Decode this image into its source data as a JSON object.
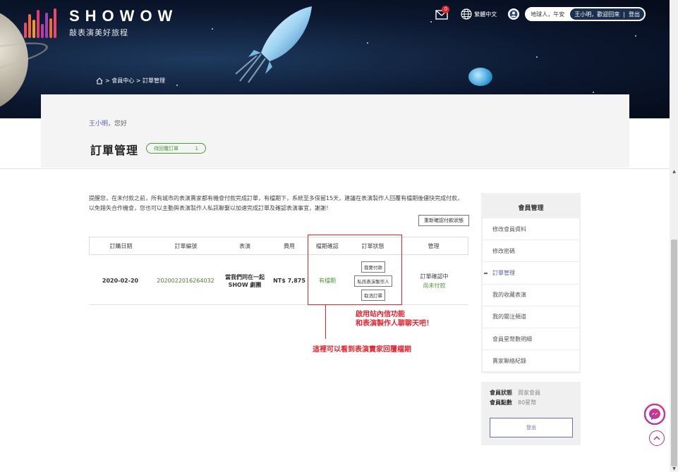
{
  "header": {
    "logo_name": "SHOWOW",
    "logo_tagline": "敲表演美好旅程",
    "mail_badge": "0",
    "language": "繁體中文",
    "user_greeting": "地球人，午安",
    "welcome_name": "王小明，歡迎回來",
    "logout_short": "登出",
    "breadcrumb": "> 會員中心 > 訂單管理"
  },
  "page": {
    "user_name": "王小明",
    "greeting_suffix": "，您好",
    "title": "訂單管理",
    "pending_label": "待回覆訂單",
    "pending_count": "1"
  },
  "notice": "提醒您，在未付款之前，所有城市的表演賣家都有機會付款完成訂單，有檔期下，系統至多保留15天，建議在表演製作人回覆有檔期後儘快完成付款，以免錯失合作機會，您也可以主動與表演製作人私訊聯繫以加速完成訂單及確認表演事宜，謝謝！",
  "reconfirm_button": "重新確認付款狀態",
  "table": {
    "headers": [
      "訂購日期",
      "訂單編號",
      "表演",
      "費用",
      "檔期確認",
      "訂單狀態",
      "管理"
    ],
    "rows": [
      {
        "date": "2020-02-20",
        "order_no": "2020022016264032",
        "show_line1": "當我們同在一起",
        "show_line2": "SHOW 劇團",
        "price": "NT$ 7,875",
        "schedule": "有檔期",
        "actions": [
          "我要付款",
          "私訊表演製作人",
          "取消訂單"
        ],
        "mgmt_status": "訂單確認中",
        "payment_status": "尚未付款"
      }
    ]
  },
  "annotations": {
    "line1": "啟用站內信功能",
    "line2": "和表演製作人聊聊天吧！",
    "line3": "這裡可以看到表演賣家回覆檔期"
  },
  "sidebar": {
    "title": "會員管理",
    "items": [
      {
        "label": "修改會員資料"
      },
      {
        "label": "修改密碼"
      },
      {
        "label": "訂單管理"
      },
      {
        "label": "我的收藏表演"
      },
      {
        "label": "我的關注頻道"
      },
      {
        "label": "會員星幣數明細"
      },
      {
        "label": "賣家聯絡紀錄"
      }
    ],
    "active_index": 2
  },
  "member": {
    "status_label": "會員狀態",
    "status_value": "買家會員",
    "points_label": "會員點數",
    "points_value": "80星幣",
    "logout_button": "登出"
  },
  "colors": {
    "accent_purple": "#5a62a8",
    "accent_green": "#4c9a3a",
    "annotation_red": "#e4232d",
    "header_navy": "#0c1830"
  }
}
